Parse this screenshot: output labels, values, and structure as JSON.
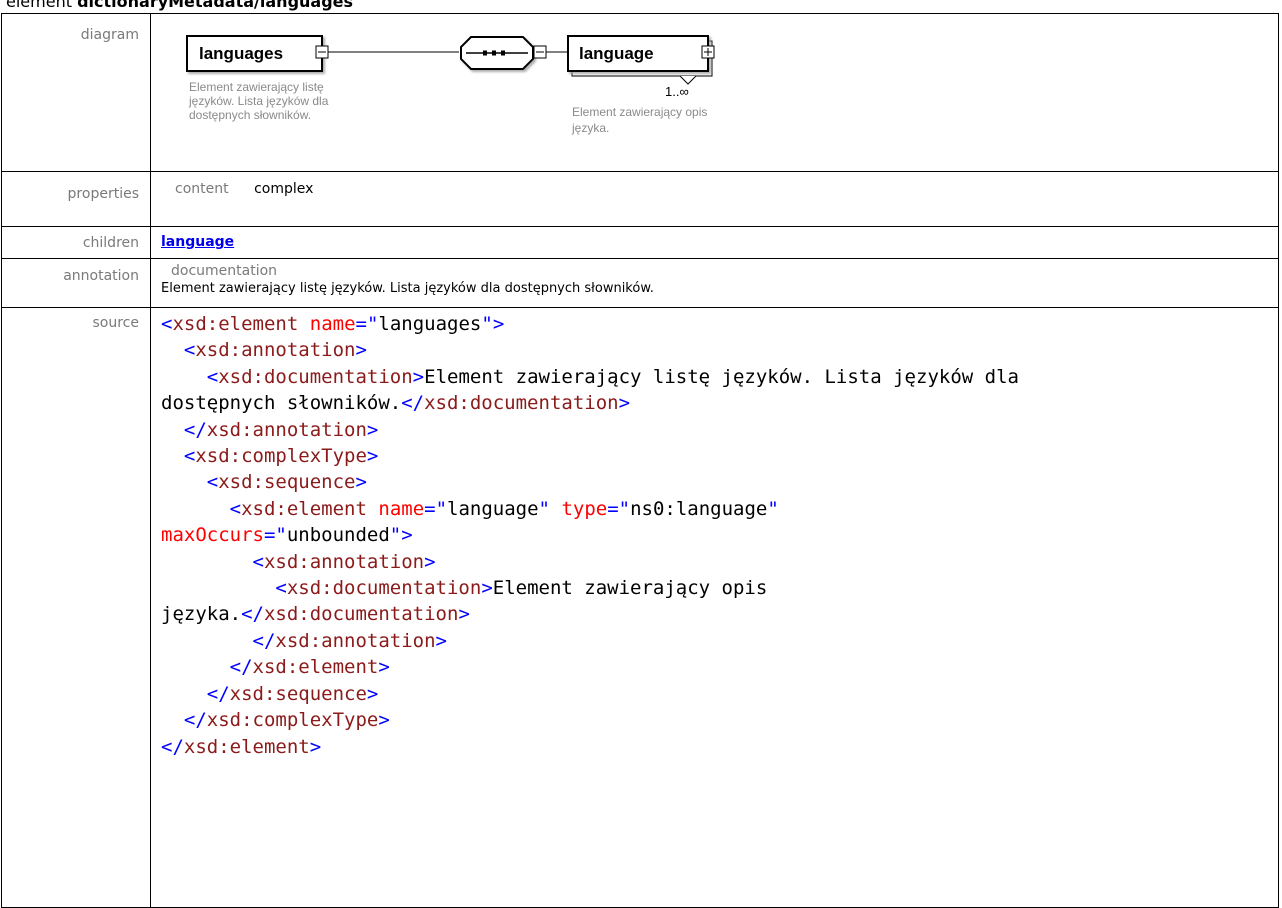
{
  "title": {
    "prefix": "element",
    "name": "dictionaryMetadata/languages"
  },
  "rows": {
    "diagram_label": "diagram",
    "properties_label": "properties",
    "children_label": "children",
    "annotation_label": "annotation",
    "source_label": "source"
  },
  "diagram": {
    "root_name": "languages",
    "root_doc": [
      "Element zawierający listę",
      "języków. Lista języków dla",
      "dostępnych słowników."
    ],
    "child_name": "language",
    "child_occurs": "1..∞",
    "child_doc": [
      "Element zawierający opis",
      "języka."
    ]
  },
  "properties": {
    "key": "content",
    "value": "complex"
  },
  "children": {
    "link": "language"
  },
  "annotation": {
    "key": "documentation",
    "text": "Element zawierający listę języków. Lista języków dla dostępnych słowników."
  },
  "source": {
    "lines": [
      [
        [
          "<",
          "t"
        ],
        [
          "xsd:element",
          "tn"
        ],
        [
          " ",
          "tx"
        ],
        [
          "name",
          "an"
        ],
        [
          "=\"",
          "t"
        ],
        [
          "languages",
          "av"
        ],
        [
          "\"",
          "t"
        ],
        [
          ">",
          "t"
        ]
      ],
      [
        [
          "  <",
          "t"
        ],
        [
          "xsd:annotation",
          "tn"
        ],
        [
          ">",
          "t"
        ]
      ],
      [
        [
          "    <",
          "t"
        ],
        [
          "xsd:documentation",
          "tn"
        ],
        [
          ">",
          "t"
        ],
        [
          "Element zawierający listę języków. Lista języków dla",
          "tx"
        ]
      ],
      [
        [
          "dostępnych słowników.",
          "tx"
        ],
        [
          "</",
          "t"
        ],
        [
          "xsd:documentation",
          "tn"
        ],
        [
          ">",
          "t"
        ]
      ],
      [
        [
          "  </",
          "t"
        ],
        [
          "xsd:annotation",
          "tn"
        ],
        [
          ">",
          "t"
        ]
      ],
      [
        [
          "  <",
          "t"
        ],
        [
          "xsd:complexType",
          "tn"
        ],
        [
          ">",
          "t"
        ]
      ],
      [
        [
          "    <",
          "t"
        ],
        [
          "xsd:sequence",
          "tn"
        ],
        [
          ">",
          "t"
        ]
      ],
      [
        [
          "      <",
          "t"
        ],
        [
          "xsd:element",
          "tn"
        ],
        [
          " ",
          "tx"
        ],
        [
          "name",
          "an"
        ],
        [
          "=\"",
          "t"
        ],
        [
          "language",
          "av"
        ],
        [
          "\" ",
          "t"
        ],
        [
          "type",
          "an"
        ],
        [
          "=\"",
          "t"
        ],
        [
          "ns0:language",
          "av"
        ],
        [
          "\"",
          "t"
        ]
      ],
      [
        [
          "maxOccurs",
          "an"
        ],
        [
          "=\"",
          "t"
        ],
        [
          "unbounded",
          "av"
        ],
        [
          "\"",
          "t"
        ],
        [
          ">",
          "t"
        ]
      ],
      [
        [
          "        <",
          "t"
        ],
        [
          "xsd:annotation",
          "tn"
        ],
        [
          ">",
          "t"
        ]
      ],
      [
        [
          "          <",
          "t"
        ],
        [
          "xsd:documentation",
          "tn"
        ],
        [
          ">",
          "t"
        ],
        [
          "Element zawierający opis",
          "tx"
        ]
      ],
      [
        [
          "języka.",
          "tx"
        ],
        [
          "</",
          "t"
        ],
        [
          "xsd:documentation",
          "tn"
        ],
        [
          ">",
          "t"
        ]
      ],
      [
        [
          "        </",
          "t"
        ],
        [
          "xsd:annotation",
          "tn"
        ],
        [
          ">",
          "t"
        ]
      ],
      [
        [
          "      </",
          "t"
        ],
        [
          "xsd:element",
          "tn"
        ],
        [
          ">",
          "t"
        ]
      ],
      [
        [
          "    </",
          "t"
        ],
        [
          "xsd:sequence",
          "tn"
        ],
        [
          ">",
          "t"
        ]
      ],
      [
        [
          "  </",
          "t"
        ],
        [
          "xsd:complexType",
          "tn"
        ],
        [
          ">",
          "t"
        ]
      ],
      [
        [
          "</",
          "t"
        ],
        [
          "xsd:element",
          "tn"
        ],
        [
          ">",
          "t"
        ]
      ]
    ]
  }
}
